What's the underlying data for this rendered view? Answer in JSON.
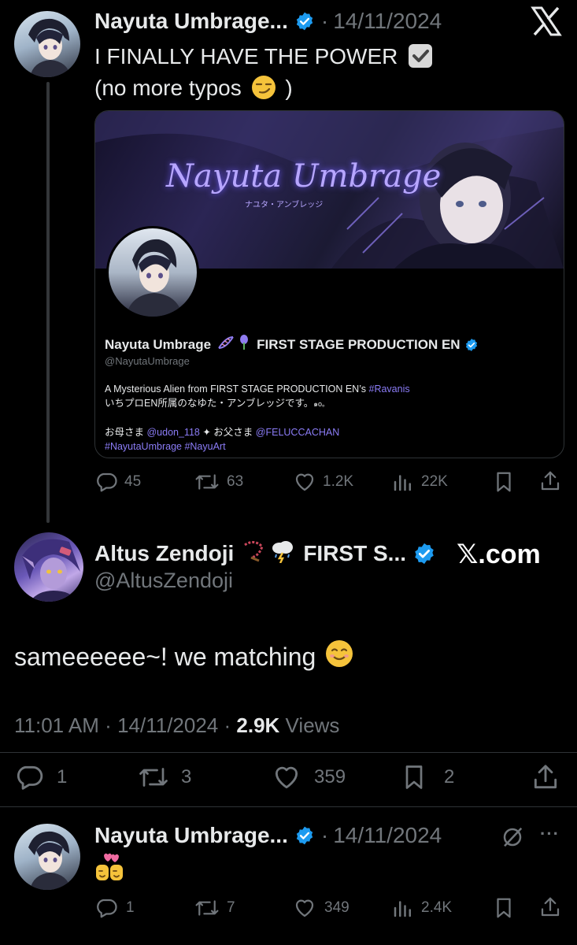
{
  "tweet1": {
    "author_name": "Nayuta Umbrage...",
    "separator": "·",
    "date": "14/11/2024",
    "line1": "I FINALLY HAVE THE POWER",
    "line2_open": "(no more typos",
    "line2_close": ")",
    "card": {
      "banner_title": "Nayuta Umbrage",
      "banner_subtitle": "ナユタ・アンブレッジ",
      "profile_name": "Nayuta Umbrage",
      "profile_suffix": "FIRST STAGE PRODUCTION EN",
      "handle": "@NayutaUmbrage",
      "bio1_text": "A Mysterious Alien from FIRST STAGE PRODUCTION EN’s ",
      "bio1_tag": "#Ravanis",
      "bio2": "いちプロEN所属のなゆた・アンブレッジです。",
      "bio2_tail": "๑o。",
      "bio3_a": "お母さま ",
      "bio3_mention1": "@udon_118",
      "bio3_b": " ✦ お父さま ",
      "bio3_mention2": "@FELUCCACHAN",
      "bio4_tag1": "#NayutaUmbrage",
      "bio4_tag2": "#NayuArt"
    },
    "actions": {
      "replies": "45",
      "reposts": "63",
      "likes": "1.2K",
      "views": "22K"
    }
  },
  "main_tweet": {
    "author_name": "Altus Zendoji",
    "author_suffix": "FIRST S...",
    "handle": "@AltusZendoji",
    "watermark": "𝕏.com",
    "text": "sameeeeee~! we matching",
    "time": "11:01 AM",
    "date": "14/11/2024",
    "views_count": "2.9K",
    "views_label": "Views",
    "actions": {
      "replies": "1",
      "reposts": "3",
      "likes": "359",
      "bookmarks": "2"
    }
  },
  "reply": {
    "author_name": "Nayuta Umbrage...",
    "separator": "·",
    "date": "14/11/2024",
    "more": "···",
    "actions": {
      "replies": "1",
      "reposts": "7",
      "likes": "349",
      "views": "2.4K"
    }
  },
  "colors": {
    "background": "#000000",
    "text": "#e7e9ea",
    "muted": "#71767b",
    "verified": "#1d9bf0",
    "link": "#8b7cf6",
    "divider": "#2f3336"
  }
}
